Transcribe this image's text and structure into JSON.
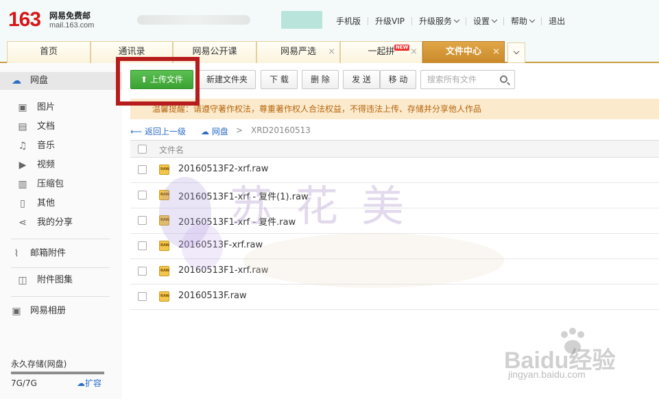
{
  "header": {
    "logo_number": "163",
    "logo_cn": "网易免费邮",
    "logo_en": "mail.163.com",
    "nav": [
      {
        "label": "手机版",
        "dropdown": false
      },
      {
        "label": "升级VIP",
        "dropdown": false
      },
      {
        "label": "升级服务",
        "dropdown": true
      },
      {
        "label": "设置",
        "dropdown": true
      },
      {
        "label": "帮助",
        "dropdown": true
      },
      {
        "label": "退出",
        "dropdown": false
      }
    ]
  },
  "tabs": [
    {
      "label": "首页",
      "closable": false,
      "active": false
    },
    {
      "label": "通讯录",
      "closable": false,
      "active": false
    },
    {
      "label": "网易公开课",
      "closable": false,
      "active": false
    },
    {
      "label": "网易严选",
      "closable": true,
      "active": false
    },
    {
      "label": "一起拼",
      "closable": true,
      "active": false,
      "badge": "NEW"
    },
    {
      "label": "文件中心",
      "closable": true,
      "active": true
    }
  ],
  "sidebar": {
    "top_item": {
      "label": "网盘",
      "icon": "cloud-drive-icon"
    },
    "categories": [
      {
        "label": "图片",
        "icon": "image-icon"
      },
      {
        "label": "文档",
        "icon": "document-icon"
      },
      {
        "label": "音乐",
        "icon": "music-icon"
      },
      {
        "label": "视频",
        "icon": "video-icon"
      },
      {
        "label": "压缩包",
        "icon": "archive-icon"
      },
      {
        "label": "其他",
        "icon": "other-file-icon"
      },
      {
        "label": "我的分享",
        "icon": "share-icon"
      }
    ],
    "attachments": {
      "label": "邮箱附件",
      "icon": "paperclip-icon"
    },
    "gallery": {
      "label": "附件图集",
      "icon": "gallery-icon"
    },
    "album": {
      "label": "网易相册",
      "icon": "photo-album-icon"
    },
    "storage": {
      "label": "永久存储(网盘)",
      "value": "7G/7G",
      "used_fraction": 1.0,
      "expand_label": "扩容"
    }
  },
  "toolbar": {
    "upload": "上传文件",
    "new_folder": "新建文件夹",
    "download": "下 载",
    "delete": "删 除",
    "send": "发 送",
    "move": "移 动",
    "search_placeholder": "搜索所有文件"
  },
  "notice": "温馨提醒：请遵守著作权法，尊重著作权人合法权益，不得违法上传、存储并分享他人作品",
  "breadcrumb": {
    "back": "返回上一级",
    "root": "网盘",
    "separator": ">",
    "current": "XRD20160513"
  },
  "table": {
    "header": "文件名",
    "files": [
      "20160513F2-xrf.raw",
      "20160513F1-xrf - 复件(1).raw",
      "20160513F1-xrf - 复件.raw",
      "20160513F-xrf.raw",
      "20160513F1-xrf.raw",
      "20160513F.raw"
    ]
  },
  "watermark": {
    "text": "苏花美"
  },
  "baidu": {
    "main": "Baidu经验",
    "sub": "jingyan.baidu.com"
  },
  "colors": {
    "brand_red": "#d71618",
    "active_tab": "#c9892a",
    "upload_green": "#3aa232",
    "link_blue": "#2a6bc5",
    "highlight_red": "#b71c1c"
  }
}
